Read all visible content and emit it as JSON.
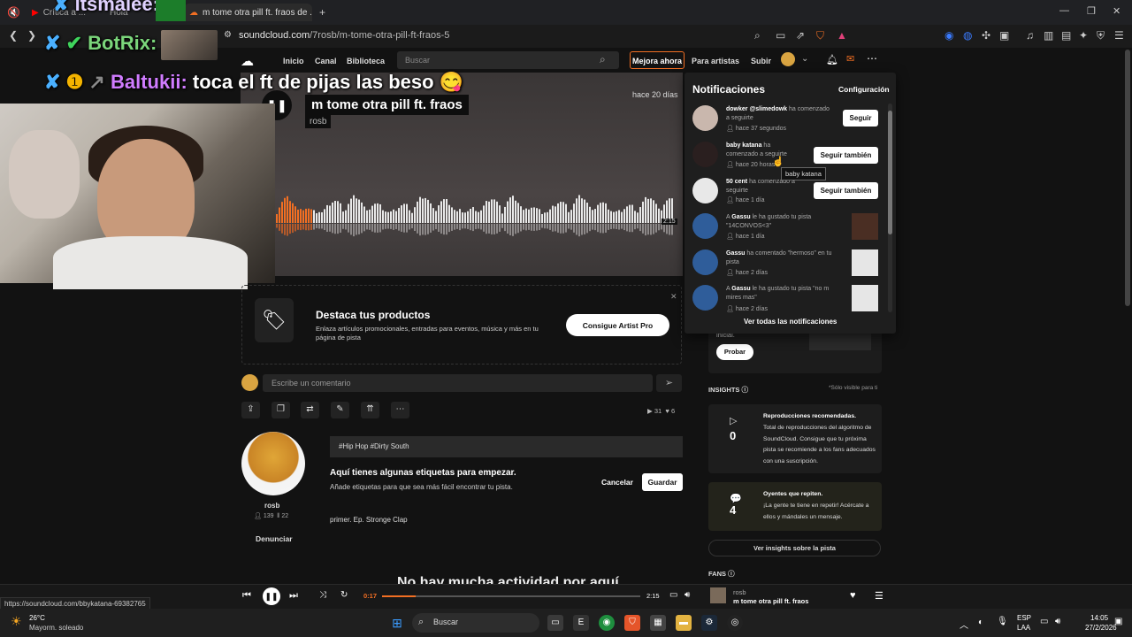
{
  "browser": {
    "tabs": [
      {
        "label": "Crítica a ..."
      },
      {
        "label": "Hola"
      },
      {
        "label": "m tome otra pill ft. fraos de ..."
      }
    ],
    "new_tab": "+",
    "url_domain": "soundcloud.com",
    "url_path": "/7rosb/m-tome-otra-pill-ft-fraos-5",
    "status_url": "https://soundcloud.com/bbykatana-69382765"
  },
  "chat_overlay": {
    "lines": [
      {
        "user": "itsmalee:",
        "message": "",
        "color": "#c9b8ff"
      },
      {
        "user": "BotRix:",
        "message": "",
        "color": "#7bd67b"
      },
      {
        "user": "Baltukii:",
        "message": "toca el ft de pijas las beso",
        "color": "#d07cff"
      }
    ]
  },
  "nav": {
    "home": "Inicio",
    "feed": "Canal",
    "library": "Biblioteca",
    "search_placeholder": "Buscar",
    "upgrade": "Mejora ahora",
    "for_artists": "Para artistas",
    "upload": "Subir"
  },
  "track": {
    "title": "m tome otra pill ft. fraos",
    "artist": "rosb",
    "age": "hace 20 días",
    "wave_time": "2:15"
  },
  "promo": {
    "title": "Destaca tus productos",
    "description": "Enlaza artículos promocionales, entradas para eventos, música y más en tu página de pista",
    "button": "Consigue Artist Pro"
  },
  "comment": {
    "placeholder": "Escribe un comentario"
  },
  "stats": {
    "plays": "31",
    "likes": "6"
  },
  "artist": {
    "name": "rosb",
    "followers": "139",
    "tracks": "22",
    "report": "Denunciar"
  },
  "tags": {
    "value": "#Hip Hop  #Dirty South",
    "title": "Aquí tienes algunas etiquetas para empezar.",
    "subtitle": "Añade etiquetas para que sea más fácil encontrar tu pista.",
    "cancel": "Cancelar",
    "save": "Guardar"
  },
  "description": "primer. Ep. Stronge Clap",
  "no_activity": "No hay mucha actividad por aquí",
  "sidebar": {
    "try_text": "inicial.",
    "try_button": "Probar",
    "insights_heading": "INSIGHTS",
    "insights_visibility": "*Sólo visible para ti",
    "cards": [
      {
        "icon": "▷",
        "number": "0",
        "title": "Reproducciones recomendadas.",
        "text": "Total de reproducciones del algoritmo de SoundCloud. Consigue que tu próxima pista se recomiende a los fans adecuados con una suscripción."
      },
      {
        "icon": "💬",
        "number": "4",
        "title": "Oyentes que repiten.",
        "text": "¡La gente te tiene en repetir! Acércate a ellos y mándales un mensaje."
      }
    ],
    "insights_button": "Ver insights sobre la pista",
    "fans_heading": "FANS"
  },
  "notifications": {
    "title": "Notificaciones",
    "config": "Configuración",
    "items": [
      {
        "user": "dowker @slimedowk",
        "action": "ha comenzado a seguirte",
        "time": "hace 37 segundos",
        "button": "Seguir"
      },
      {
        "user": "baby katana",
        "action": "ha comenzado a seguirte",
        "time": "hace 20 horas",
        "button": "Seguir también"
      },
      {
        "user": "50 cent",
        "action": "ha comenzado a seguirte",
        "time": "hace 1 día",
        "button": "Seguir también"
      },
      {
        "prefix": "A",
        "user": "Gassu",
        "action": "le ha gustado tu pista \"14CONVOS<3\"",
        "time": "hace 1 día"
      },
      {
        "user": "Gassu",
        "action": "ha comentado \"hermoso\" en tu pista",
        "time": "hace 2 días"
      },
      {
        "prefix": "A",
        "user": "Gassu",
        "action": "le ha gustado tu pista \"no m mires mas\"",
        "time": "hace 2 días"
      }
    ],
    "view_all": "Ver todas las notificaciones",
    "tooltip": "baby katana"
  },
  "player": {
    "current": "0:17",
    "duration": "2:15",
    "artist": "rosb",
    "title": "m tome otra pill ft. fraos"
  },
  "taskbar": {
    "weather_temp": "26°C",
    "weather_desc": "Mayorm. soleado",
    "search": "Buscar",
    "lang1": "ESP",
    "lang2": "LAA",
    "time": "14:05",
    "date": "27/2/2026"
  },
  "colors": {
    "accent": "#f26f23",
    "page_bg": "#121212",
    "panel_bg": "#1e1e1e"
  }
}
